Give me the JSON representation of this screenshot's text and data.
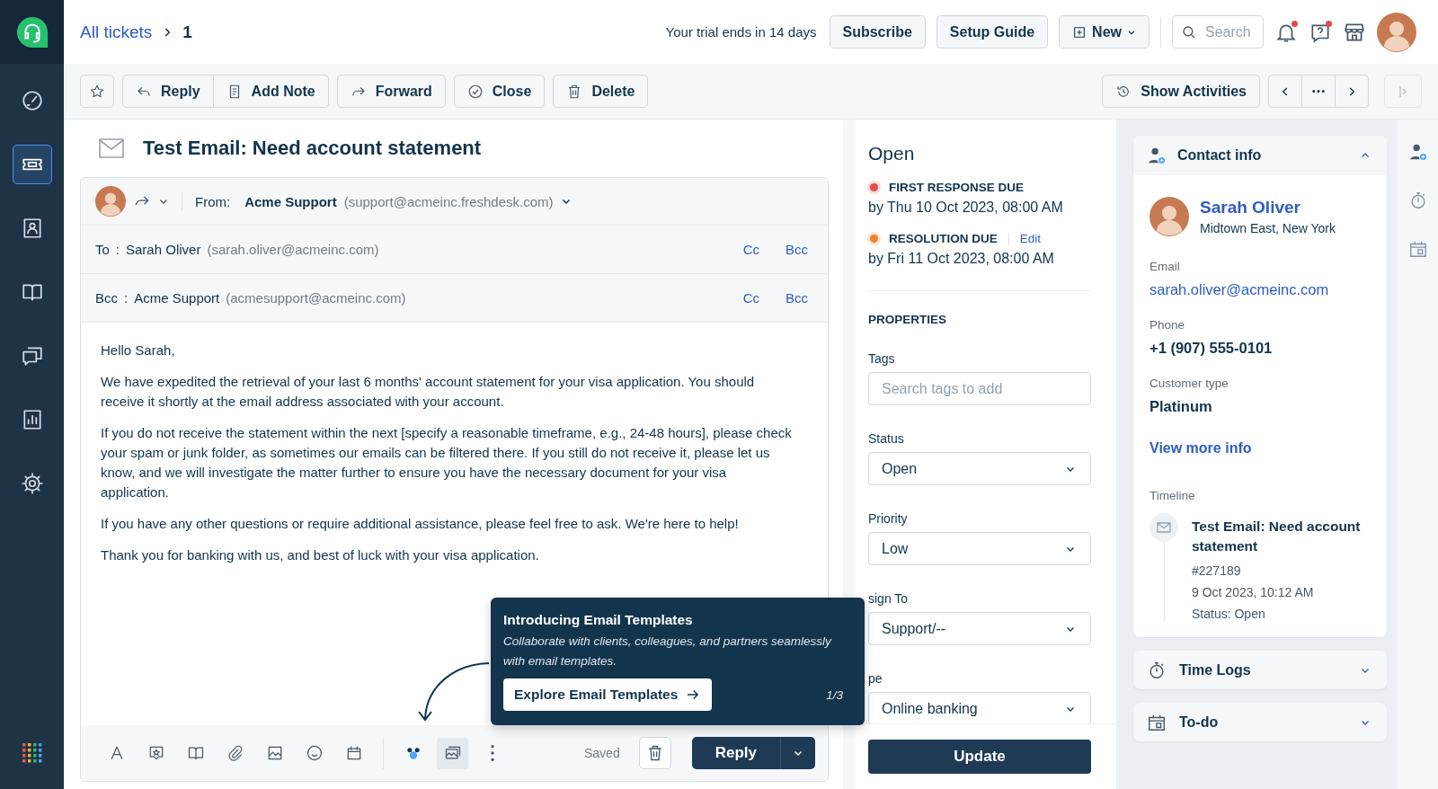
{
  "sidebar": {
    "items": [
      {
        "selected": false
      },
      {
        "selected": true
      },
      {
        "selected": false
      },
      {
        "selected": false
      },
      {
        "selected": false
      },
      {
        "selected": false
      },
      {
        "selected": false
      }
    ]
  },
  "header": {
    "breadcrumb": {
      "link": "All tickets",
      "current": "1"
    },
    "trial": "Your trial ends in 14 days",
    "buttons": [
      "Subscribe",
      "Setup Guide"
    ],
    "new_button": "New",
    "search": {
      "placeholder": "Search"
    },
    "notifications_unread": true,
    "help_unread": true
  },
  "toolbar": {
    "starred": false,
    "actions": [
      "Reply",
      "Add Note",
      "Forward",
      "Close",
      "Delete"
    ],
    "show_activities": "Show Activities"
  },
  "ticket": {
    "title": "Test Email: Need account statement",
    "from": {
      "label": "From:",
      "name": "Acme Support",
      "email": "(support@acmeinc.freshdesk.com)"
    },
    "recipients": [
      {
        "label": "To",
        "separator": ":",
        "name": "Sarah Oliver",
        "email": "(sarah.oliver@acmeinc.com)",
        "cc": "Cc",
        "bcc": "Bcc"
      },
      {
        "label": "Bcc",
        "separator": ":",
        "name": "Acme Support",
        "email": "(acmesupport@acmeinc.com)",
        "cc": "Cc",
        "bcc": "Bcc"
      }
    ],
    "body": [
      "Hello Sarah,",
      "We have expedited the retrieval of your last 6 months' account statement for your visa application. You should receive it shortly at the email address associated with your account.",
      "If you do not receive the statement within the next [specify a reasonable timeframe, e.g., 24-48 hours], please check your spam or junk folder, as sometimes our emails can be filtered there. If you still do not receive it, please let us know, and we will investigate the matter further to ensure you have the necessary document for your visa application.",
      "If you have any other questions or require additional assistance, please feel free to ask. We're here to help!",
      "Thank you for banking with us, and best of luck with your visa application."
    ],
    "composer_tools": [
      {
        "selected": false
      },
      {
        "selected": false
      },
      {
        "selected": false
      },
      {
        "selected": false
      },
      {
        "selected": false
      },
      {
        "selected": false
      },
      {
        "selected": false
      },
      {
        "selected": false
      },
      {
        "selected": true
      },
      {
        "selected": false
      }
    ],
    "saved": "Saved",
    "reply_button": "Reply"
  },
  "tooltip": {
    "title": "Introducing Email Templates",
    "text": "Collaborate with clients, colleagues, and partners seamlessly with email templates.",
    "action": "Explore Email Templates",
    "step": "1/3"
  },
  "status": {
    "title": "Open",
    "sla": [
      {
        "label": "FIRST RESPONSE DUE",
        "due": "by Thu 10 Oct 2023, 08:00 AM",
        "color": "#e5484d"
      },
      {
        "label": "RESOLUTION DUE",
        "edit": "Edit",
        "due": "by Fri 11 Oct 2023, 08:00 AM",
        "color": "#f0812f"
      }
    ]
  },
  "properties": {
    "heading": "PROPERTIES",
    "tags": {
      "label": "Tags",
      "placeholder": "Search tags to add"
    },
    "fields": [
      {
        "label": "Status",
        "value": "Open"
      },
      {
        "label": "Priority",
        "value": "Low"
      },
      {
        "label": "sign To",
        "value": "Support/--"
      },
      {
        "label": "pe",
        "value": "Online banking"
      }
    ],
    "update": "Update"
  },
  "contact": {
    "title": "Contact info",
    "expanded": true,
    "name": "Sarah Oliver",
    "location": "Midtown East, New York",
    "details": [
      {
        "label": "Email",
        "value": "sarah.oliver@acmeinc.com",
        "kind": "link"
      },
      {
        "label": "Phone",
        "value": "+1 (907) 555-0101",
        "kind": "text"
      },
      {
        "label": "Customer type",
        "value": "Platinum",
        "kind": "text"
      }
    ],
    "view_more": "View more info",
    "timeline": {
      "label": "Timeline",
      "items": [
        {
          "title": "Test Email: Need account statement",
          "id": "#227189",
          "time": "9 Oct 2023, 10:12 AM",
          "status": "Status: Open"
        }
      ]
    }
  },
  "sections": [
    {
      "title": "Time Logs",
      "expanded": false
    },
    {
      "title": "To-do",
      "expanded": false
    }
  ]
}
